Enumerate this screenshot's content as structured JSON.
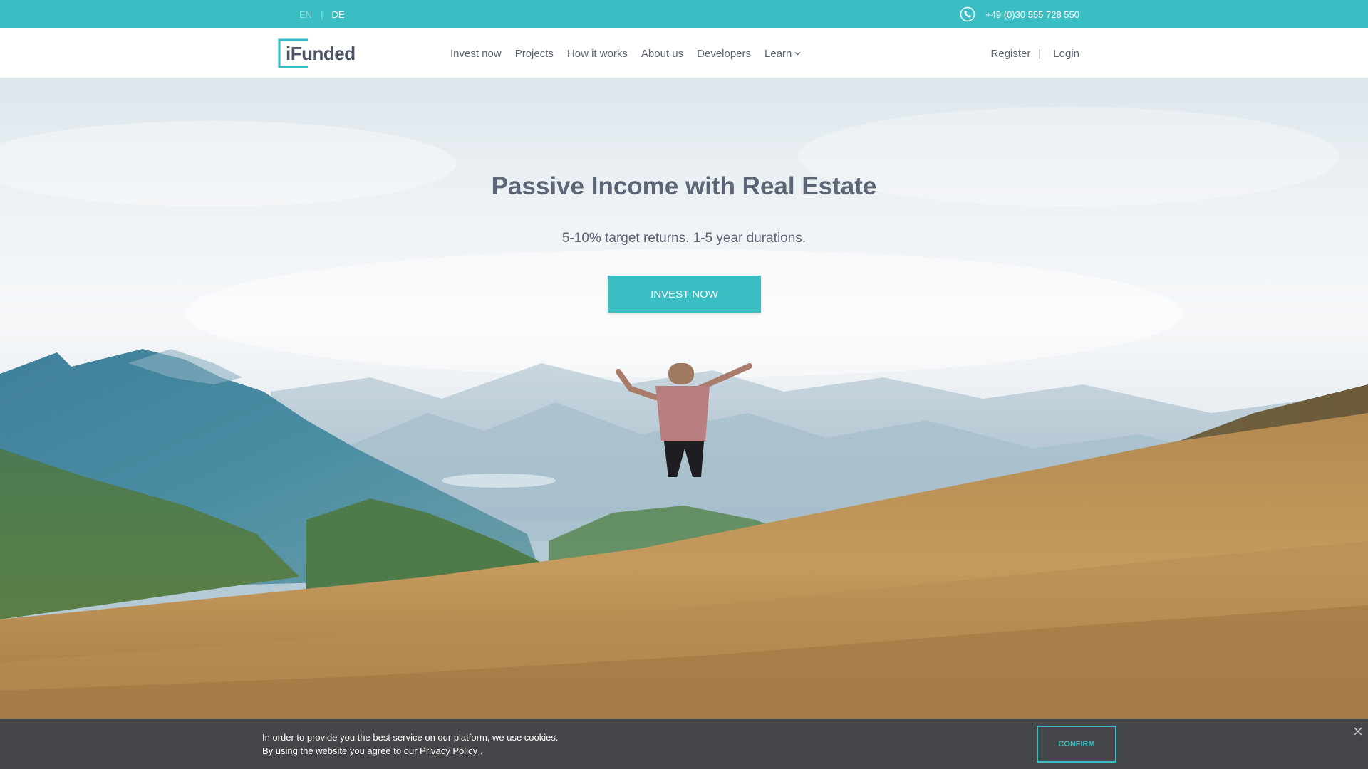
{
  "topbar": {
    "languages": {
      "en": "EN",
      "separator": "|",
      "de": "DE"
    },
    "phone": {
      "icon": "phone-icon",
      "number": "+49 (0)30 555 728 550"
    }
  },
  "header": {
    "logo_text": "iFunded",
    "nav": [
      {
        "label": "Invest now"
      },
      {
        "label": "Projects"
      },
      {
        "label": "How it works"
      },
      {
        "label": "About us"
      },
      {
        "label": "Developers"
      },
      {
        "label": "Learn",
        "icon": "chevron-down-icon"
      }
    ],
    "auth": {
      "register": "Register",
      "separator": "|",
      "login": "Login"
    }
  },
  "hero": {
    "title": "Passive Income with Real Estate",
    "subtitle": "5-10% target returns. 1-5 year durations.",
    "cta": "INVEST NOW"
  },
  "cookie": {
    "line1": "In order to provide you the best service on our platform, we use cookies.",
    "line2_prefix": "By using the website you agree to our",
    "link": "Privacy Policy",
    "line2_suffix": ".",
    "confirm": "CONFIRM",
    "close_icon": "close-icon"
  },
  "colors": {
    "accent": "#3bbec3",
    "text": "#5b6575",
    "cookie_bg": "#34363a"
  }
}
